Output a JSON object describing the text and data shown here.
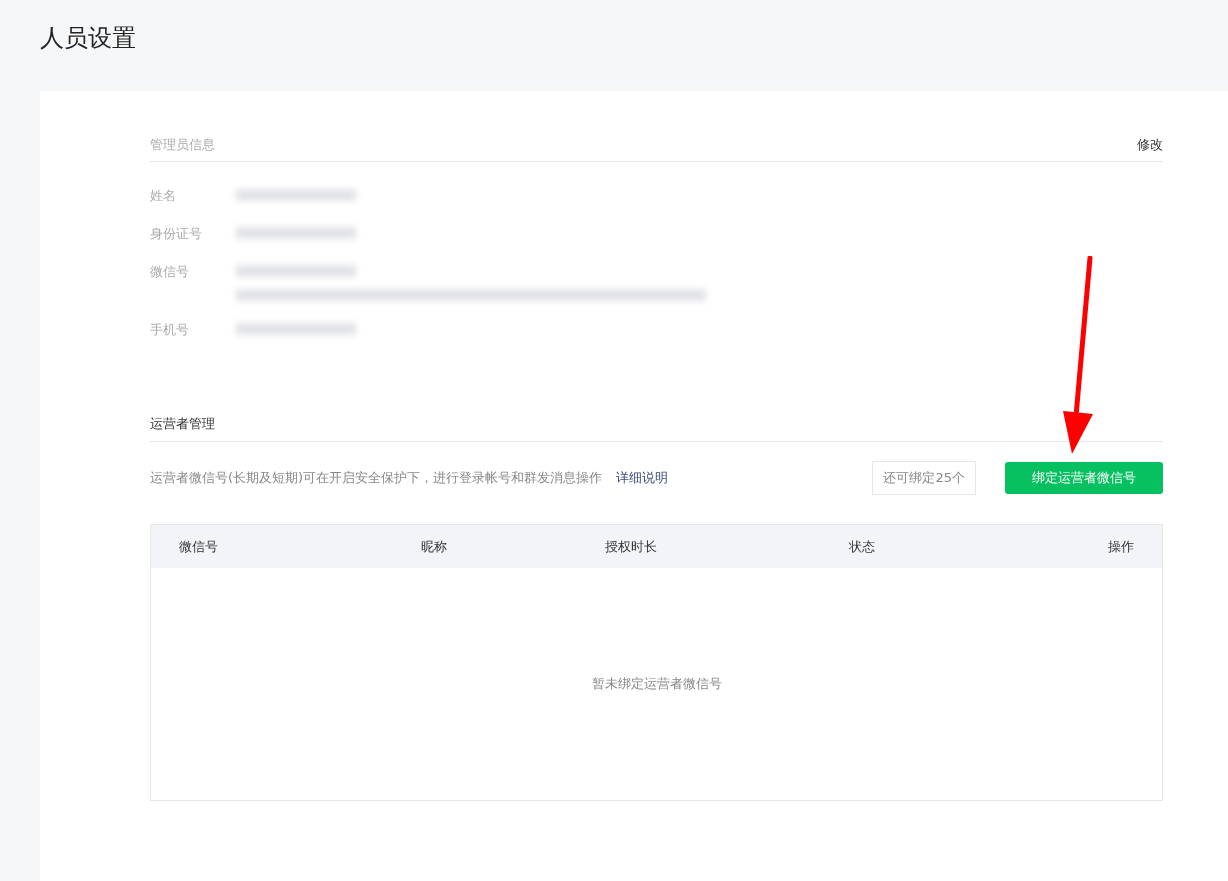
{
  "page_title": "人员设置",
  "admin_info": {
    "title": "管理员信息",
    "edit_link": "修改",
    "fields": [
      {
        "label": "姓名",
        "kind": "short"
      },
      {
        "label": "身份证号",
        "kind": "short"
      },
      {
        "label": "微信号",
        "kind": "double"
      },
      {
        "label": "手机号",
        "kind": "short"
      }
    ]
  },
  "operator_management": {
    "title": "运营者管理",
    "description": "运营者微信号(长期及短期)可在开启安全保护下，进行登录帐号和群发消息操作",
    "detail_link": "详细说明",
    "remaining": "还可绑定25个",
    "bind_button": "绑定运营者微信号",
    "table": {
      "columns": [
        "微信号",
        "昵称",
        "授权时长",
        "状态",
        "操作"
      ],
      "empty_text": "暂未绑定运营者微信号"
    }
  }
}
